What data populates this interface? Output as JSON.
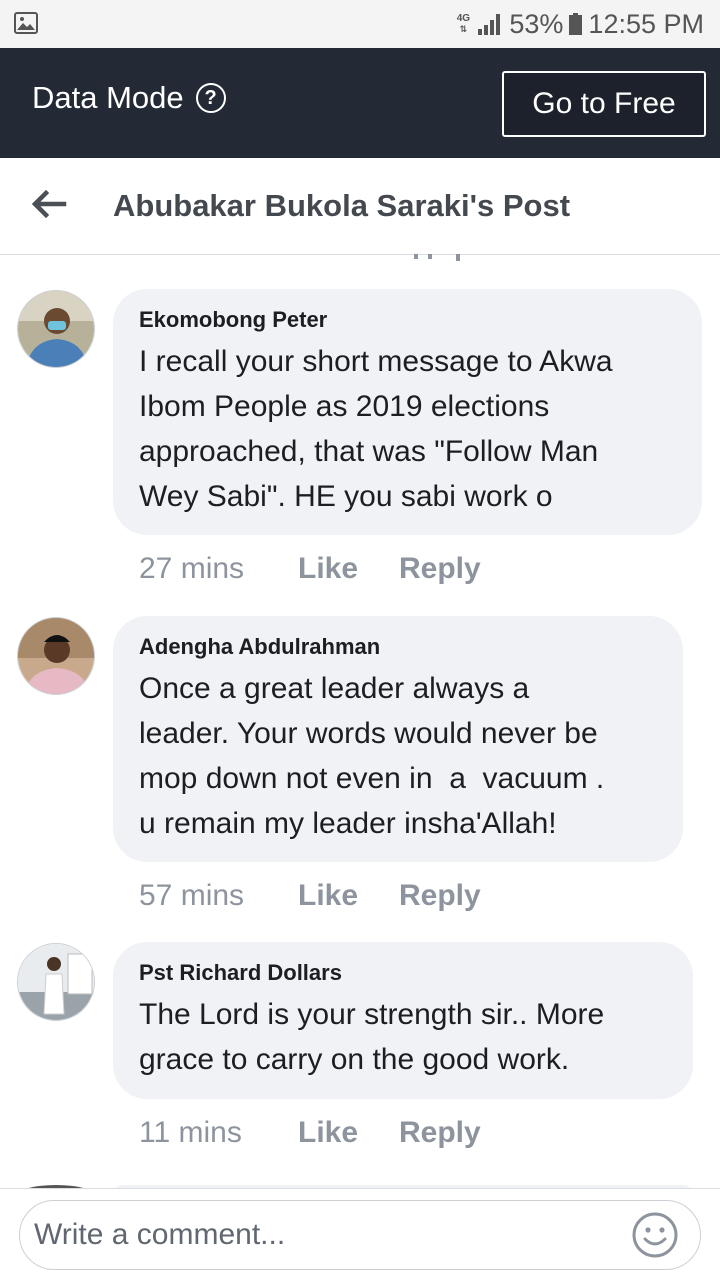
{
  "status_bar": {
    "network": "4G",
    "battery_percent": "53%",
    "time": "12:55 PM",
    "icons": [
      "gallery-icon",
      "network-4g-icon",
      "signal-icon",
      "battery-icon"
    ]
  },
  "data_mode": {
    "label": "Data Mode",
    "help_icon": "help-icon",
    "go_free_label": "Go to Free"
  },
  "header": {
    "back_icon": "back-arrow-icon",
    "title": "Abubakar Bukola Saraki's Post"
  },
  "comments": [
    {
      "author": "Ekomobong Peter",
      "lines": [
        "I recall your short message to Akwa",
        "Ibom People as 2019 elections",
        "approached, that was \"Follow Man",
        "Wey Sabi\". HE you sabi work o"
      ],
      "time": "27 mins",
      "like": "Like",
      "reply": "Reply"
    },
    {
      "author": "Adengha Abdulrahman",
      "lines": [
        "Once a great leader always a",
        "leader. Your words would never be",
        "mop down not even in  a  vacuum .",
        "u remain my leader insha'Allah!"
      ],
      "time": "57 mins",
      "like": "Like",
      "reply": "Reply"
    },
    {
      "author": "Pst Richard Dollars",
      "lines": [
        "The Lord is your strength sir.. More",
        "grace to carry on the good work."
      ],
      "time": "11 mins",
      "like": "Like",
      "reply": "Reply"
    }
  ],
  "composer": {
    "placeholder": "Write a comment...",
    "emoji_icon": "smiley-icon"
  },
  "colors": {
    "status_bar_bg": "#f4f4f4",
    "data_bar_bg": "#242936",
    "bubble_bg": "#f0f2f5",
    "meta_text": "#8d949e"
  }
}
